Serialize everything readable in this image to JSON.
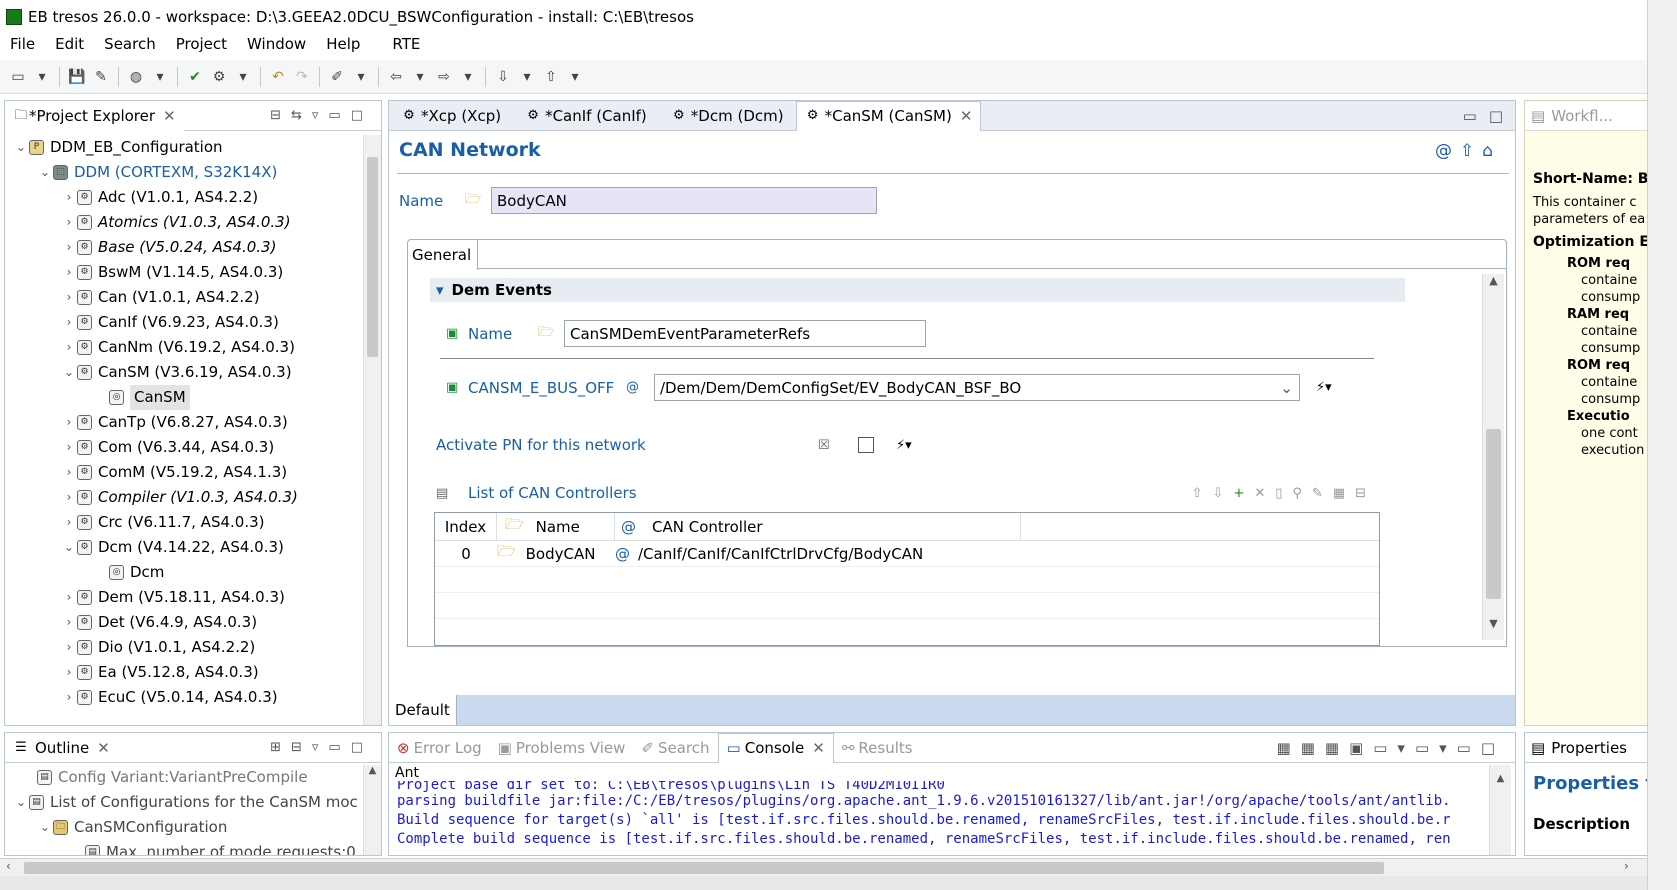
{
  "window": {
    "title": "EB tresos 26.0.0 - workspace: D:\\3.GEEA2.0DCU_BSWConfiguration - install: C:\\EB\\tresos"
  },
  "menu": [
    "File",
    "Edit",
    "Search",
    "Project",
    "Window",
    "Help",
    "RTE"
  ],
  "project_explorer": {
    "title": "*Project Explorer",
    "items": [
      {
        "label": "DDM_EB_Configuration",
        "style": "normal"
      },
      {
        "label": "DDM (CORTEXM, S32K14X)",
        "style": "blue"
      },
      {
        "label": "Adc (V1.0.1, AS4.2.2)",
        "style": "normal"
      },
      {
        "label": "Atomics (V1.0.3, AS4.0.3)",
        "style": "italic"
      },
      {
        "label": "Base (V5.0.24, AS4.0.3)",
        "style": "italic"
      },
      {
        "label": "BswM (V1.14.5, AS4.0.3)",
        "style": "normal"
      },
      {
        "label": "Can (V1.0.1, AS4.2.2)",
        "style": "normal"
      },
      {
        "label": "CanIf (V6.9.23, AS4.0.3)",
        "style": "normal"
      },
      {
        "label": "CanNm (V6.19.2, AS4.0.3)",
        "style": "normal"
      },
      {
        "label": "CanSM (V3.6.19, AS4.0.3)",
        "style": "normal"
      },
      {
        "label": "CanSM",
        "style": "selected"
      },
      {
        "label": "CanTp (V6.8.27, AS4.0.3)",
        "style": "normal"
      },
      {
        "label": "Com (V6.3.44, AS4.0.3)",
        "style": "normal"
      },
      {
        "label": "ComM (V5.19.2, AS4.1.3)",
        "style": "normal"
      },
      {
        "label": "Compiler (V1.0.3, AS4.0.3)",
        "style": "italic"
      },
      {
        "label": "Crc (V6.11.7, AS4.0.3)",
        "style": "normal"
      },
      {
        "label": "Dcm (V4.14.22, AS4.0.3)",
        "style": "normal"
      },
      {
        "label": "Dcm",
        "style": "normal"
      },
      {
        "label": "Dem (V5.18.11, AS4.0.3)",
        "style": "normal"
      },
      {
        "label": "Det (V6.4.9, AS4.0.3)",
        "style": "normal"
      },
      {
        "label": "Dio (V1.0.1, AS4.2.2)",
        "style": "normal"
      },
      {
        "label": "Ea (V5.12.8, AS4.0.3)",
        "style": "normal"
      },
      {
        "label": "EcuC (V5.0.14, AS4.0.3)",
        "style": "normal"
      }
    ]
  },
  "editor_tabs": [
    "*Xcp (Xcp)",
    "*CanIf (CanIf)",
    "*Dcm (Dcm)",
    "*CanSM (CanSM)"
  ],
  "editor": {
    "heading": "CAN Network",
    "name_label": "Name",
    "name_value": "BodyCAN",
    "general_tab": "General",
    "dem_section": "Dem Events",
    "dem_name_label": "Name",
    "dem_name_value": "CanSMDemEventParameterRefs",
    "bus_off_label": "CANSM_E_BUS_OFF",
    "bus_off_value": "/Dem/Dem/DemConfigSet/EV_BodyCAN_BSF_BO",
    "activate_pn_label": "Activate PN for this network",
    "controllers_label": "List of CAN Controllers",
    "table": {
      "headers": [
        "Index",
        "Name",
        "CAN Controller"
      ],
      "rows": [
        [
          "0",
          "BodyCAN",
          "/CanIf/CanIf/CanIfCtrlDrvCfg/BodyCAN"
        ]
      ]
    },
    "bottom_tab": "Default"
  },
  "workflow": {
    "title": "Workfl..."
  },
  "description_panel": {
    "short_name": "Short-Name: Bo",
    "text1": "This container c",
    "text2": "parameters of ea",
    "opt_title": "Optimization Ef",
    "bullets": [
      {
        "head": "ROM req",
        "lines": [
          "containe",
          "consump"
        ]
      },
      {
        "head": "RAM req",
        "lines": [
          "containe",
          "consump"
        ]
      },
      {
        "head": "ROM req",
        "lines": [
          "containe",
          "consump"
        ]
      },
      {
        "head": "Executio",
        "lines": [
          "one cont",
          "execution"
        ]
      }
    ]
  },
  "outline": {
    "title": "Outline",
    "items": [
      {
        "label": "Config Variant:VariantPreCompile"
      },
      {
        "label": "List of Configurations for the CanSM moc"
      },
      {
        "label": "CanSMConfiguration"
      },
      {
        "label": "Max. number of mode requests:0"
      }
    ]
  },
  "bottom_tabs": [
    "Error Log",
    "Problems View",
    "Search",
    "Console",
    "Results"
  ],
  "console": {
    "name": "Ant",
    "lines": [
      "Project base dir set to: C:\\EB\\tresos\\plugins\\Lin_TS_T40D2M10I1R0",
      "parsing buildfile jar:file:/C:/EB/tresos/plugins/org.apache.ant_1.9.6.v201510161327/lib/ant.jar!/org/apache/tools/ant/antlib.",
      "Build sequence for target(s) `all' is [test.if.src.files.should.be.renamed, renameSrcFiles, test.if.include.files.should.be.r",
      "Complete build sequence is [test.if.src.files.should.be.renamed, renameSrcFiles, test.if.include.files.should.be.renamed, ren"
    ]
  },
  "properties": {
    "title": "Properties",
    "heading": "Properties fo",
    "description": "Description"
  }
}
